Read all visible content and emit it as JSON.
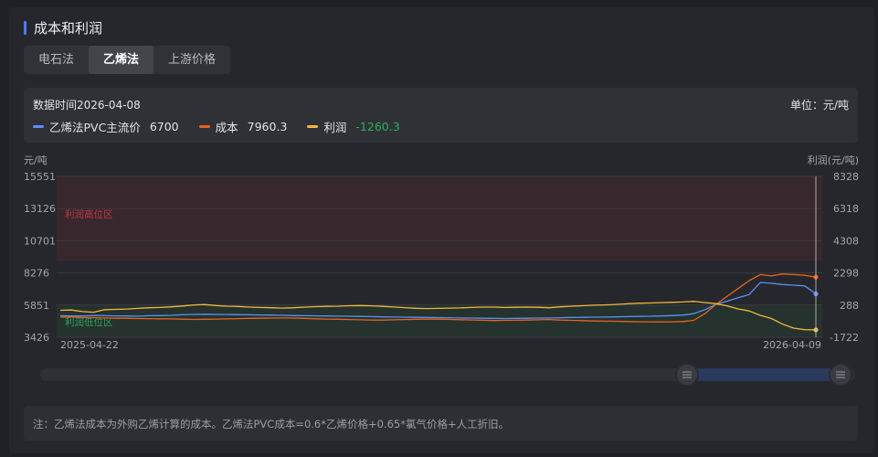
{
  "section": {
    "title": "成本和利润"
  },
  "tabs": [
    {
      "label": "电石法",
      "active": false
    },
    {
      "label": "乙烯法",
      "active": true
    },
    {
      "label": "上游价格",
      "active": false
    }
  ],
  "header": {
    "data_time": "数据时间2026-04-08",
    "unit": "单位：元/吨"
  },
  "legend": [
    {
      "name": "乙烯法PVC主流价",
      "value": "6700",
      "color": "#5b8ff9"
    },
    {
      "name": "成本",
      "value": "7960.3",
      "color": "#e8641b"
    },
    {
      "name": "利润",
      "value": "-1260.3",
      "color": "#f0b840",
      "negative": true
    }
  ],
  "zones": {
    "high": "利润高位区",
    "low": "利润低位区"
  },
  "note": "注：乙烯法成本为外购乙烯计算的成本。乙烯法PVC成本=0.6*乙烯价格+0.65*氯气价格+人工折旧。",
  "chart_data": {
    "type": "line",
    "x_start": "2025-04-22",
    "x_end": "2026-04-09",
    "x_tick_labels": [
      "2025-04-22",
      "2026-04-09"
    ],
    "y_left": {
      "label": "元/吨",
      "ticks": [
        3426,
        5851,
        8276,
        10701,
        13126,
        15551
      ],
      "range": [
        3426,
        15551
      ]
    },
    "y_right": {
      "label": "利润(元/吨)",
      "ticks": [
        -1722,
        288,
        2298,
        4308,
        6318,
        8328
      ],
      "range": [
        -1722,
        8328
      ]
    },
    "zones": [
      {
        "name": "利润高位区",
        "axis": "right",
        "from": 3070,
        "to": 8328,
        "color": "#b5343a"
      },
      {
        "name": "利润低位区",
        "axis": "right",
        "from": -1722,
        "to": 288,
        "color": "#1f6b3a"
      }
    ],
    "grid": true,
    "series": [
      {
        "name": "乙烯法PVC主流价",
        "axis": "left",
        "color": "#5b8ff9",
        "values": [
          5050,
          5040,
          5040,
          5060,
          5050,
          5040,
          5030,
          5020,
          5050,
          5060,
          5080,
          5120,
          5150,
          5160,
          5150,
          5140,
          5130,
          5120,
          5110,
          5100,
          5080,
          5060,
          5050,
          5040,
          5030,
          5020,
          5010,
          5000,
          4980,
          4960,
          4950,
          4940,
          4930,
          4920,
          4910,
          4900,
          4880,
          4870,
          4860,
          4850,
          4840,
          4850,
          4860,
          4870,
          4880,
          4900,
          4920,
          4930,
          4940,
          4950,
          4960,
          4980,
          5000,
          5010,
          5030,
          5060,
          5100,
          5200,
          5500,
          5900,
          6150,
          6400,
          6650,
          7550,
          7500,
          7400,
          7350,
          7300,
          6700
        ]
      },
      {
        "name": "成本",
        "axis": "left",
        "color": "#e8641b",
        "values": [
          4950,
          4960,
          4920,
          4900,
          4880,
          4860,
          4850,
          4840,
          4830,
          4820,
          4810,
          4790,
          4770,
          4780,
          4800,
          4810,
          4830,
          4850,
          4860,
          4870,
          4880,
          4870,
          4850,
          4820,
          4800,
          4780,
          4760,
          4740,
          4720,
          4720,
          4740,
          4760,
          4780,
          4800,
          4790,
          4770,
          4750,
          4730,
          4710,
          4690,
          4700,
          4710,
          4720,
          4740,
          4760,
          4720,
          4700,
          4680,
          4650,
          4640,
          4630,
          4610,
          4600,
          4590,
          4580,
          4590,
          4610,
          4700,
          5200,
          5900,
          6500,
          7100,
          7700,
          8150,
          8050,
          8200,
          8150,
          8100,
          7960
        ]
      },
      {
        "name": "利润",
        "axis": "right",
        "color": "#f0b840",
        "values": [
          -40,
          -20,
          -120,
          -160,
          0,
          20,
          40,
          80,
          120,
          140,
          180,
          230,
          300,
          320,
          260,
          220,
          200,
          160,
          140,
          120,
          100,
          120,
          160,
          190,
          210,
          220,
          250,
          260,
          240,
          210,
          170,
          130,
          90,
          70,
          80,
          100,
          110,
          140,
          160,
          160,
          140,
          150,
          160,
          150,
          120,
          180,
          220,
          250,
          280,
          300,
          330,
          370,
          400,
          420,
          440,
          460,
          480,
          520,
          450,
          380,
          240,
          50,
          -80,
          -350,
          -550,
          -900,
          -1150,
          -1250,
          -1260.3
        ]
      }
    ]
  }
}
